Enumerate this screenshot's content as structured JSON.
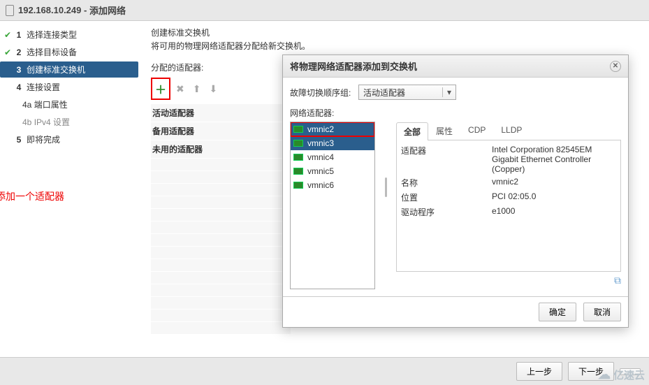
{
  "window": {
    "host": "192.168.10.249",
    "title_suffix": "添加网络"
  },
  "wizard": {
    "steps": [
      {
        "num": "1",
        "label": "选择连接类型",
        "done": true
      },
      {
        "num": "2",
        "label": "选择目标设备",
        "done": true
      },
      {
        "num": "3",
        "label": "创建标准交换机",
        "active": true
      },
      {
        "num": "4",
        "label": "连接设置"
      },
      {
        "num": "4a",
        "label": "端口属性",
        "sub": true,
        "dark": true
      },
      {
        "num": "4b",
        "label": "IPv4 设置",
        "sub": true
      },
      {
        "num": "5",
        "label": "即将完成"
      }
    ]
  },
  "content": {
    "heading": "创建标准交换机",
    "subheading": "将可用的物理网络适配器分配给新交换机。",
    "assigned_label": "分配的适配器:",
    "groups": {
      "active": "活动适配器",
      "standby": "备用适配器",
      "unused": "未用的适配器"
    },
    "annotation": "添加一个适配器"
  },
  "modal": {
    "title": "将物理网络适配器添加到交换机",
    "failover_label": "故障切换顺序组:",
    "failover_value": "活动适配器",
    "adapters_label": "网络适配器:",
    "nics": [
      "vmnic2",
      "vmnic3",
      "vmnic4",
      "vmnic5",
      "vmnic6"
    ],
    "tabs": {
      "all": "全部",
      "props": "属性",
      "cdp": "CDP",
      "lldp": "LLDP"
    },
    "properties": {
      "adapter_key": "适配器",
      "adapter_val": "Intel Corporation 82545EM Gigabit Ethernet Controller (Copper)",
      "name_key": "名称",
      "name_val": "vmnic2",
      "loc_key": "位置",
      "loc_val": "PCI 02:05.0",
      "driver_key": "驱动程序",
      "driver_val": "e1000"
    },
    "ok": "确定",
    "cancel": "取消"
  },
  "footer": {
    "back": "上一步",
    "next": "下一步",
    "final": ""
  },
  "logo": "亿速云"
}
